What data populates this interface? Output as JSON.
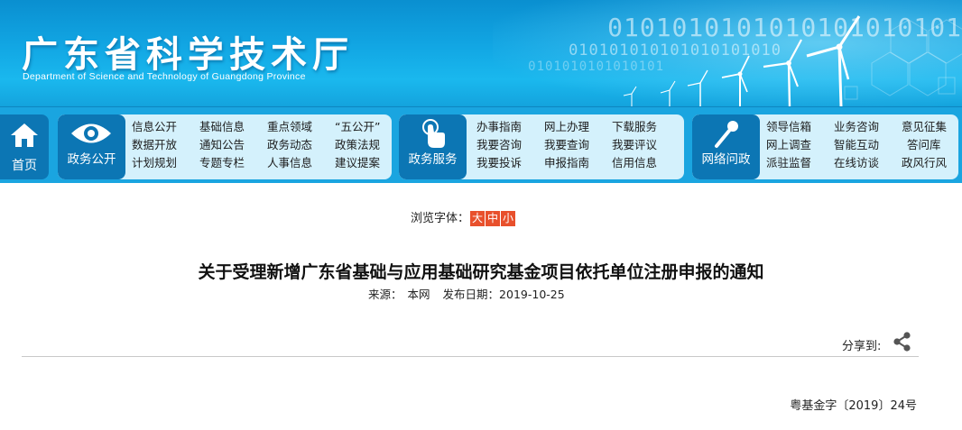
{
  "header": {
    "title": "广东省科学技术厅",
    "subtitle": "Department of Science and Technology of Guangdong Province",
    "binary_row1": "0101010101010101010101",
    "binary_row2": "010101010101010101010",
    "binary_row3": "0101010101010101"
  },
  "nav": {
    "home": {
      "label": "首页",
      "icon": "home-icon"
    },
    "groups": [
      {
        "label": "政务公开",
        "icon": "eye-icon",
        "links": [
          [
            "信息公开",
            "基础信息",
            "重点领域",
            "“五公开”"
          ],
          [
            "数据开放",
            "通知公告",
            "政务动态",
            "政策法规"
          ],
          [
            "计划规划",
            "专题专栏",
            "人事信息",
            "建议提案"
          ]
        ]
      },
      {
        "label": "政务服务",
        "icon": "hand-pointer-icon",
        "links": [
          [
            "办事指南",
            "网上办理",
            "下载服务"
          ],
          [
            "我要咨询",
            "我要查询",
            "我要评议"
          ],
          [
            "我要投诉",
            "申报指南",
            "信用信息"
          ]
        ]
      },
      {
        "label": "网络问政",
        "icon": "microphone-icon",
        "links": [
          [
            "领导信箱",
            "业务咨询",
            "意见征集"
          ],
          [
            "网上调查",
            "智能互动",
            "答问库"
          ],
          [
            "派驻监督",
            "在线访谈",
            "政风行风"
          ]
        ]
      }
    ]
  },
  "content": {
    "font_size_label": "浏览字体：",
    "font_sizes": [
      "大",
      "中",
      "小"
    ],
    "title": "关于受理新增广东省基础与应用基础研究基金项目依托单位注册申报的通知",
    "source_label": "来源：",
    "source": "本网",
    "date_label": "发布日期：",
    "date": "2019-10-25",
    "share_label": "分享到:",
    "doc_number": "粤基金字〔2019〕24号"
  },
  "colors": {
    "banner": "#12a7e4",
    "nav_bg": "#1aa5e0",
    "tile": "#0c76b4",
    "link_panel": "#d4f1fc",
    "font_button": "#e8502c"
  }
}
